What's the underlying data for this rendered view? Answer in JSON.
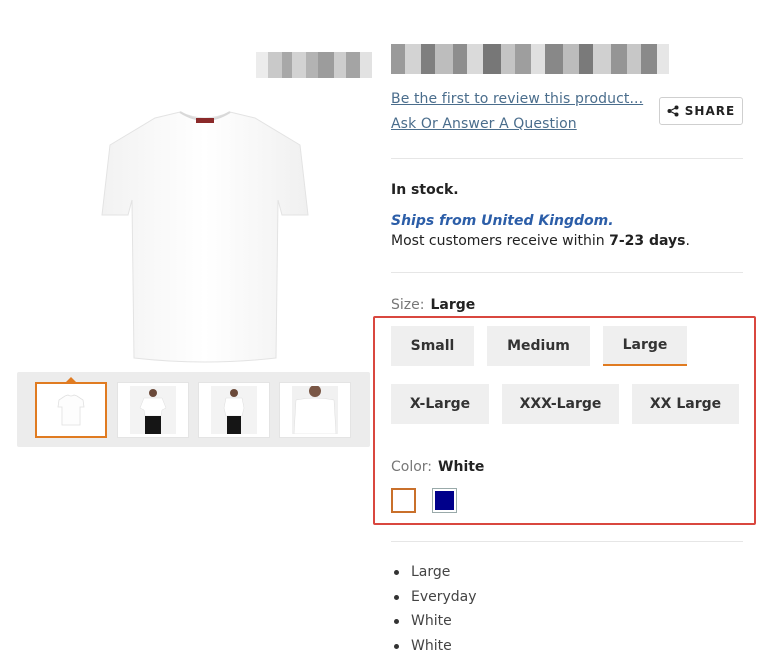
{
  "product": {
    "review_link": "Be the first to review this product...",
    "qa_link": "Ask Or Answer A Question",
    "share_label": "SHARE",
    "stock_status": "In stock.",
    "ships_from": "Ships from United Kingdom.",
    "receive_prefix": "Most customers receive within ",
    "receive_days": "7-23 days",
    "receive_suffix": "."
  },
  "size": {
    "label": "Size:",
    "selected": "Large",
    "options": [
      "Small",
      "Medium",
      "Large",
      "X-Large",
      "XXX-Large",
      "XX Large"
    ]
  },
  "color": {
    "label": "Color:",
    "selected": "White",
    "swatches": [
      {
        "name": "White",
        "hex": "#ffffff"
      },
      {
        "name": "Navy",
        "hex": "#00008b"
      }
    ]
  },
  "features": [
    "Large",
    "Everyday",
    "White",
    "White"
  ],
  "colors": {
    "accent": "#e07b21",
    "link": "#4a6d8c",
    "ships": "#2c5ea8",
    "highlight": "#d9473f"
  }
}
